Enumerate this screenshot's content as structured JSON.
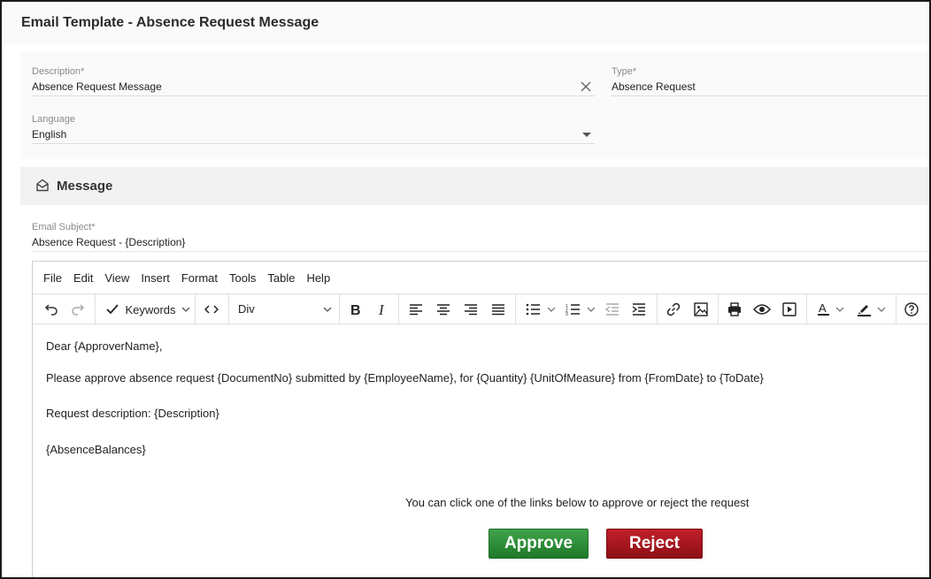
{
  "page": {
    "title": "Email Template - Absence Request Message"
  },
  "form": {
    "description": {
      "label": "Description*",
      "value": "Absence Request Message"
    },
    "type": {
      "label": "Type*",
      "value": "Absence Request"
    },
    "language": {
      "label": "Language",
      "value": "English"
    }
  },
  "message_section": {
    "title": "Message",
    "icon": "envelope-open-icon",
    "subject": {
      "label": "Email Subject*",
      "value": "Absence Request - {Description}"
    }
  },
  "editor": {
    "menu": [
      "File",
      "Edit",
      "View",
      "Insert",
      "Format",
      "Tools",
      "Table",
      "Help"
    ],
    "toolbar": {
      "keywords_label": "Keywords",
      "block_format": "Div",
      "icons": [
        "undo-icon",
        "redo-icon",
        "check-icon",
        "code-icon",
        "bold-icon",
        "italic-icon",
        "align-left-icon",
        "align-center-icon",
        "align-right-icon",
        "align-justify-icon",
        "bullet-list-icon",
        "numbered-list-icon",
        "outdent-icon",
        "indent-icon",
        "link-icon",
        "image-icon",
        "print-icon",
        "preview-icon",
        "media-icon",
        "text-color-icon",
        "highlight-icon",
        "help-icon"
      ]
    },
    "body": {
      "greeting": "Dear {ApproverName},",
      "line1": "Please approve absence request {DocumentNo} submitted by {EmployeeName}, for {Quantity}  {UnitOfMeasure} from {FromDate} to {ToDate}",
      "line2": "Request description: {Description}",
      "line3": "{AbsenceBalances}",
      "cta_text": "You can click one of the links below to approve or reject the request",
      "approve_label": "Approve",
      "reject_label": "Reject"
    }
  },
  "colors": {
    "approve": "#2e8b3a",
    "reject": "#a8161f",
    "section_bg": "#f2f2f2"
  }
}
